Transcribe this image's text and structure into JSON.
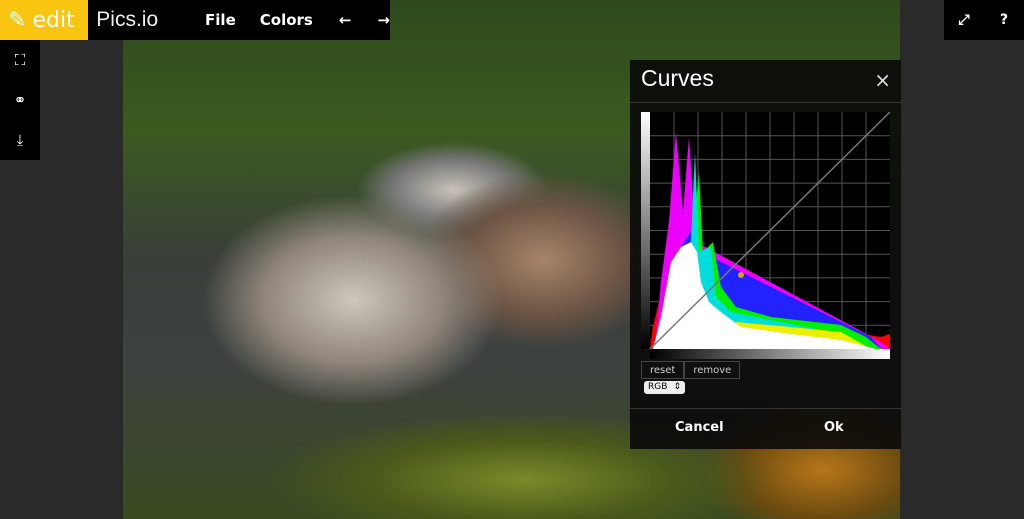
{
  "toolbar": {
    "edit_label": "edit",
    "brand": "Pics.io",
    "menu": [
      "File",
      "Colors"
    ],
    "undo_icon": "arrow-left",
    "redo_icon": "arrow-right"
  },
  "sidebar": {
    "icons": [
      "crop-icon",
      "color-circles-icon",
      "download-icon"
    ]
  },
  "top_right": {
    "fullscreen_icon": "expand-icon",
    "help_label": "?"
  },
  "dialog": {
    "title": "Curves",
    "close_icon": "×",
    "reset_label": "reset",
    "remove_label": "remove",
    "channel_select": "RGB",
    "cancel_label": "Cancel",
    "ok_label": "Ok",
    "control_point_color": "#e39a1b"
  }
}
